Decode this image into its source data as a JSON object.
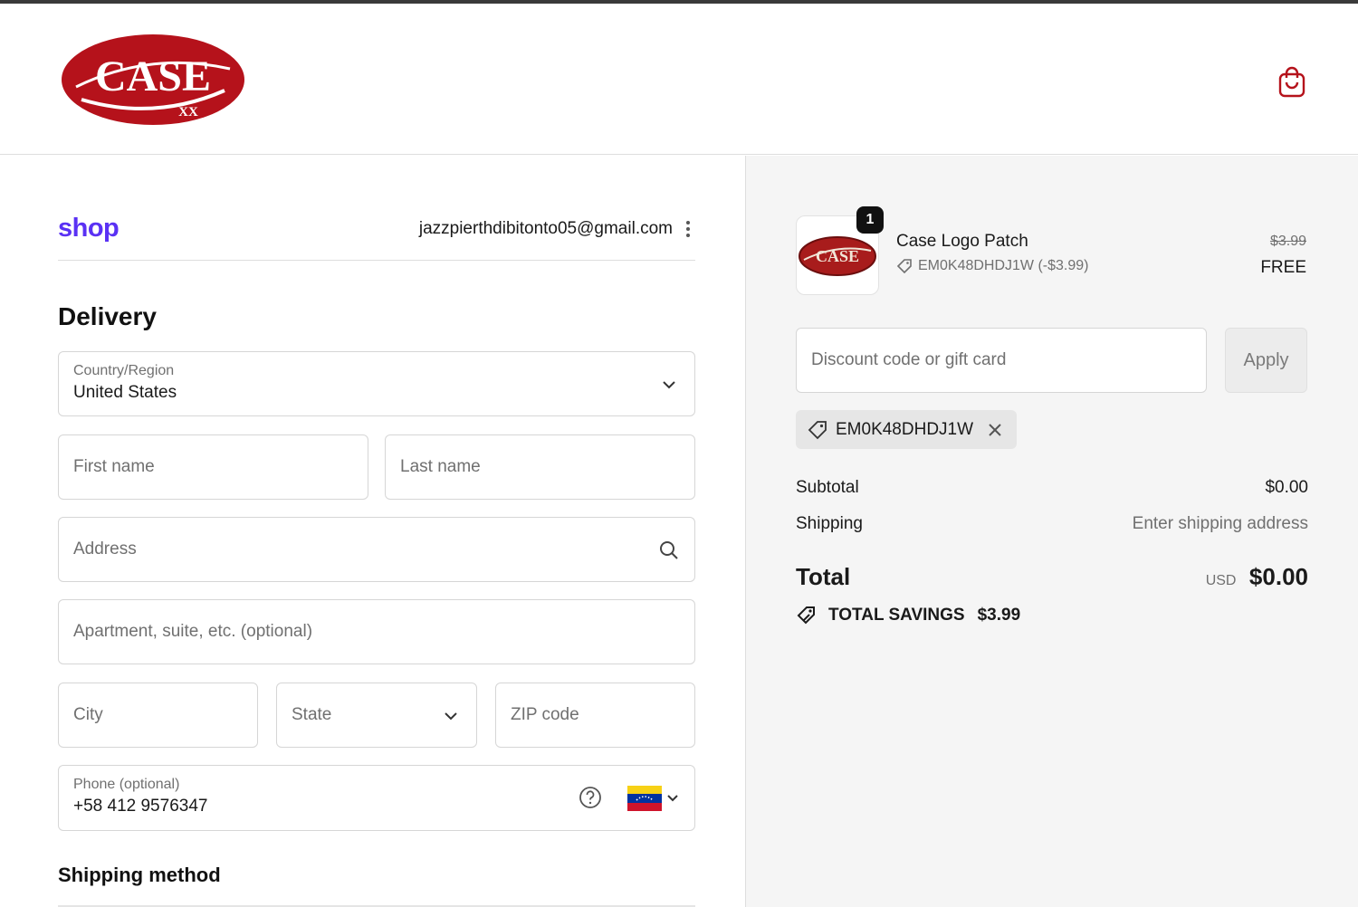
{
  "header": {
    "brand": "CASE",
    "brand_mark": "XX",
    "cart_icon": "shopping-bag-icon"
  },
  "account": {
    "shop_logo": "shop",
    "email": "jazzpierthdibitonto05@gmail.com"
  },
  "delivery": {
    "title": "Delivery",
    "country": {
      "label": "Country/Region",
      "value": "United States"
    },
    "first_name": {
      "placeholder": "First name"
    },
    "last_name": {
      "placeholder": "Last name"
    },
    "address": {
      "placeholder": "Address"
    },
    "apartment": {
      "placeholder": "Apartment, suite, etc. (optional)"
    },
    "city": {
      "placeholder": "City"
    },
    "state": {
      "placeholder": "State"
    },
    "zip": {
      "placeholder": "ZIP code"
    },
    "phone": {
      "label": "Phone (optional)",
      "value": "+58 412 9576347",
      "country_flag": "venezuela-flag-icon"
    }
  },
  "shipping_method": {
    "title": "Shipping method"
  },
  "order": {
    "item": {
      "quantity": "1",
      "name": "Case Logo Patch",
      "code": "EM0K48DHDJ1W (-$3.99)",
      "price_original": "$3.99",
      "price_final": "FREE"
    },
    "discount": {
      "placeholder": "Discount code or gift card",
      "apply_label": "Apply"
    },
    "applied_code": "EM0K48DHDJ1W",
    "subtotal": {
      "label": "Subtotal",
      "value": "$0.00"
    },
    "shipping": {
      "label": "Shipping",
      "value": "Enter shipping address"
    },
    "total": {
      "label": "Total",
      "currency": "USD",
      "value": "$0.00"
    },
    "savings": {
      "label": "TOTAL SAVINGS",
      "value": "$3.99"
    }
  },
  "colors": {
    "brand_red": "#b5121b",
    "shop_purple": "#5a31f4",
    "sidebar_bg": "#f5f5f5"
  }
}
